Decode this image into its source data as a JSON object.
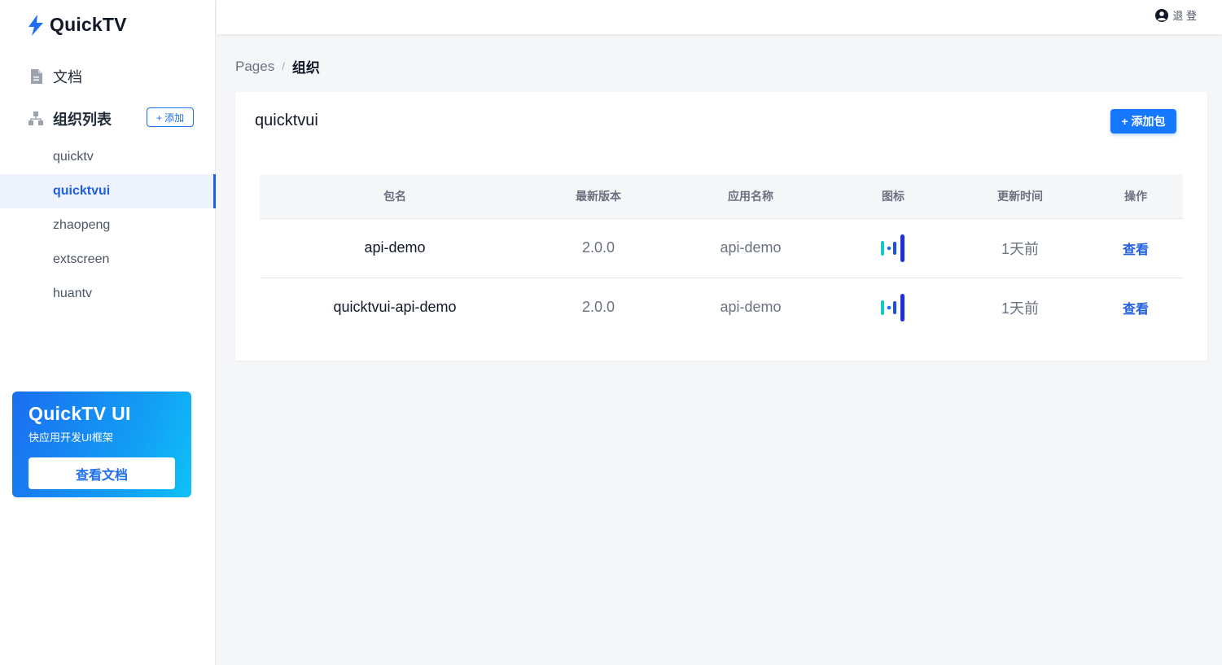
{
  "brand": {
    "name": "QuickTV"
  },
  "sidebar": {
    "docs_label": "文档",
    "orgs_label": "组织列表",
    "add_org_label": "+ 添加",
    "orgs": [
      {
        "label": "quicktv",
        "active": false
      },
      {
        "label": "quicktvui",
        "active": true
      },
      {
        "label": "zhaopeng",
        "active": false
      },
      {
        "label": "extscreen",
        "active": false
      },
      {
        "label": "huantv",
        "active": false
      }
    ],
    "promo": {
      "title": "QuickTV UI",
      "subtitle": "快应用开发UI框架",
      "button_label": "查看文档"
    }
  },
  "topbar": {
    "logout_label": "退 登"
  },
  "breadcrumb": {
    "root": "Pages",
    "separator": "/",
    "current": "组织"
  },
  "card": {
    "title": "quicktvui",
    "add_package_label": "+ 添加包",
    "table": {
      "headers": [
        "包名",
        "最新版本",
        "应用名称",
        "图标",
        "更新时间",
        "操作"
      ],
      "rows": [
        {
          "package": "api-demo",
          "version": "2.0.0",
          "app_name": "api-demo",
          "icon": "audio-bars-icon",
          "updated": "1天前",
          "action": "查看"
        },
        {
          "package": "quicktvui-api-demo",
          "version": "2.0.0",
          "app_name": "api-demo",
          "icon": "audio-bars-icon",
          "updated": "1天前",
          "action": "查看"
        }
      ]
    }
  },
  "colors": {
    "accent": "#1677ff",
    "active_text": "#1f5fe0",
    "promo_start": "#1a6df0",
    "promo_end": "#0fc2f7",
    "icon_teal": "#18c9c0",
    "icon_blue": "#1d2fe0"
  }
}
